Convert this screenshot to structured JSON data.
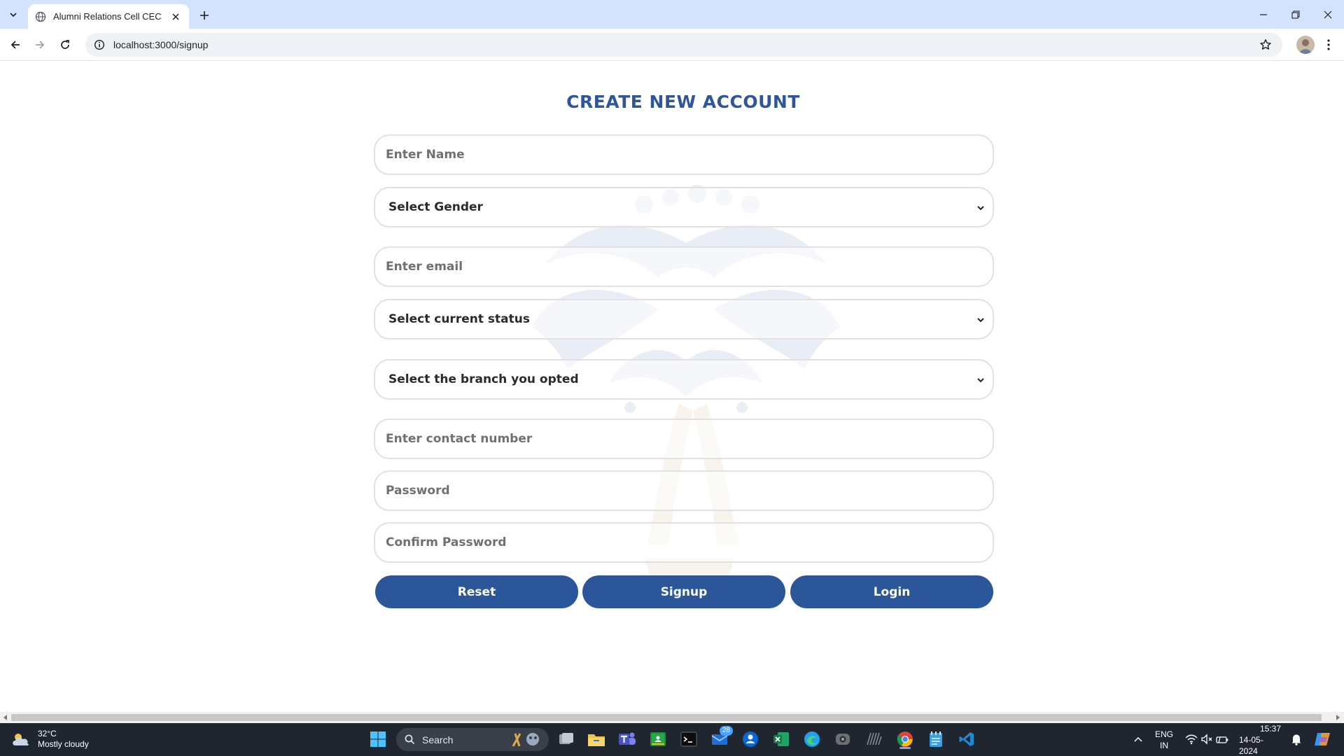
{
  "browser": {
    "tab_title": "Alumni Relations Cell CEC",
    "url": "localhost:3000/signup"
  },
  "form": {
    "heading": "CREATE NEW ACCOUNT",
    "name_placeholder": "Enter Name",
    "gender_select": "Select Gender",
    "email_placeholder": "Enter email",
    "status_select": "Select current status",
    "branch_select": "Select the branch you opted",
    "contact_placeholder": "Enter contact number",
    "password_placeholder": "Password",
    "confirm_password_placeholder": "Confirm Password",
    "reset_label": "Reset",
    "signup_label": "Signup",
    "login_label": "Login"
  },
  "taskbar": {
    "temperature": "32°C",
    "weather": "Mostly cloudy",
    "search_label": "Search",
    "mail_badge": "28",
    "lang_primary": "ENG",
    "lang_secondary": "IN",
    "time": "15:37",
    "date": "14-05-2024"
  },
  "colors": {
    "brand": "#2b579a",
    "heading": "#2f569a",
    "tabbar": "#d3e3fd",
    "taskbar": "#202630"
  }
}
